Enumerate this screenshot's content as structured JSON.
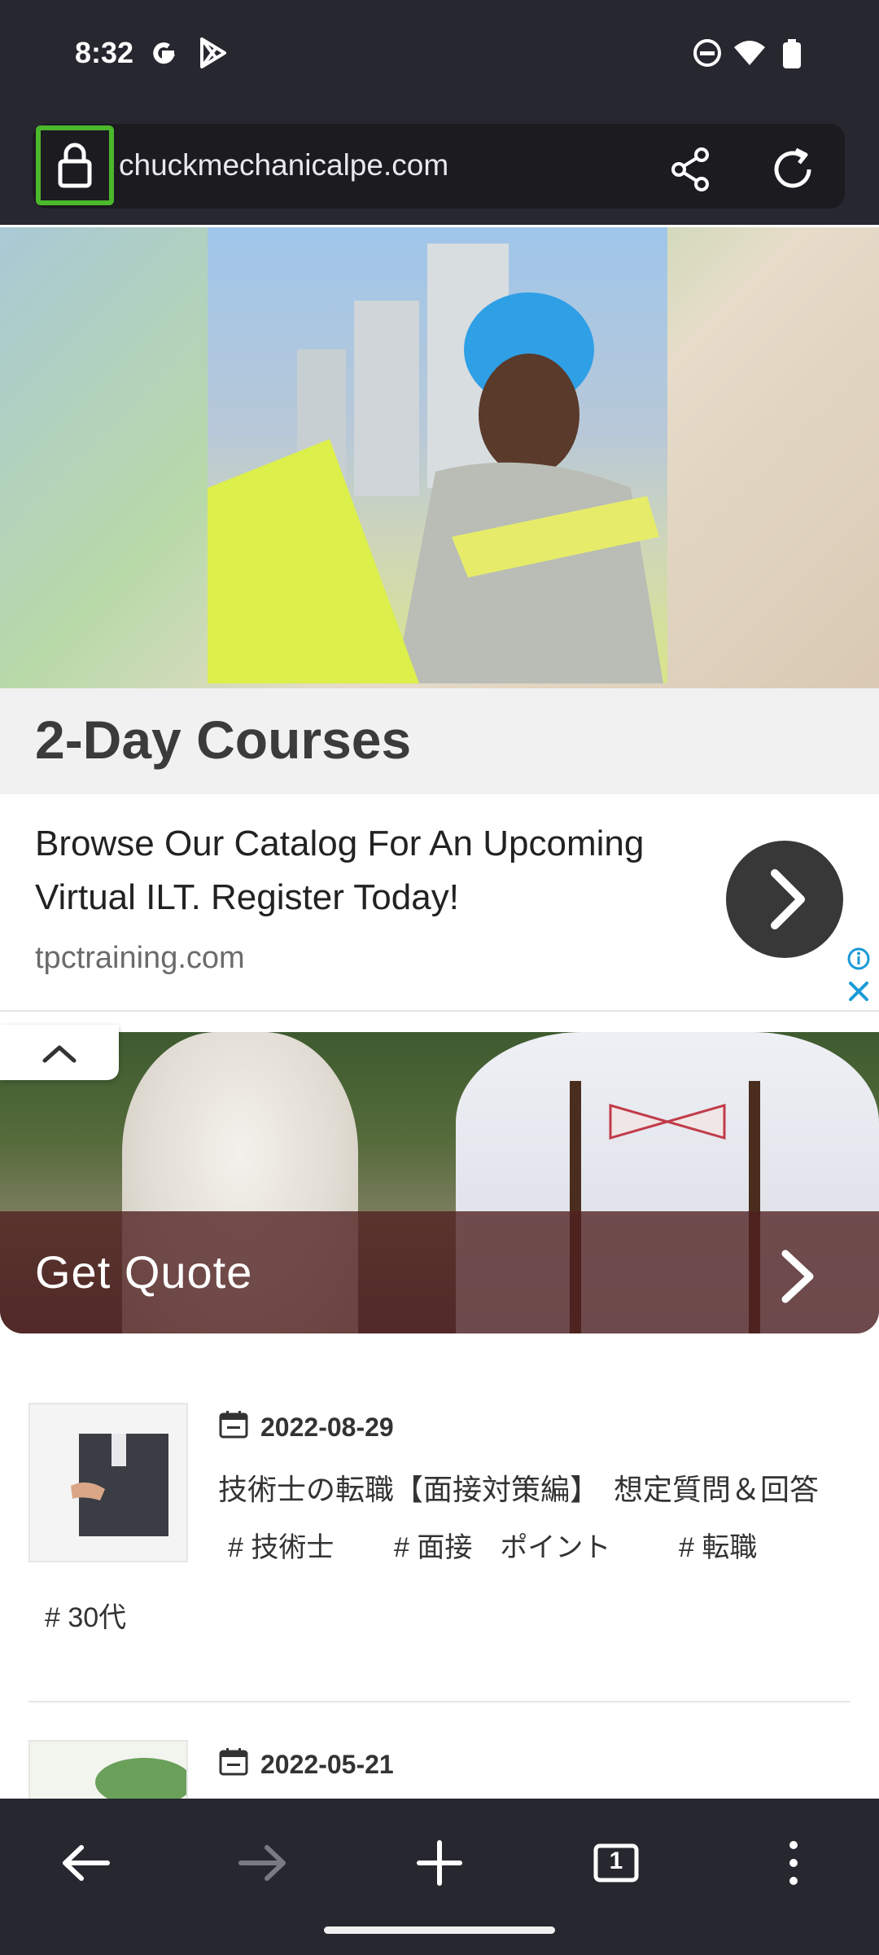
{
  "status_bar": {
    "time": "8:32",
    "left_icons": [
      "google-icon",
      "play-store-icon"
    ],
    "right_icons": [
      "do-not-disturb-icon",
      "wifi-icon",
      "battery-icon"
    ]
  },
  "browser": {
    "url": "chuckmechanicalpe.com",
    "share_label": "share",
    "reload_label": "reload",
    "tab_count": "1"
  },
  "ad": {
    "title": "2-Day Courses",
    "description": "Browse Our Catalog For An Upcoming Virtual ILT. Register Today!",
    "domain": "tpctraining.com"
  },
  "banner": {
    "cta": "Get Quote"
  },
  "articles": [
    {
      "date": "2022-08-29",
      "title": "技術士の転職【面接対策編】　想定質問＆回答",
      "tags": [
        "# 技術士",
        "# 面接　ポイント",
        "# 転職",
        "# 30代"
      ]
    },
    {
      "date": "2022-05-21"
    }
  ],
  "colors": {
    "chrome_bg": "#272730",
    "url_bar_bg": "#1b1b20",
    "focus_outline": "#4cb82c",
    "ad_cta_bg": "#383838",
    "quote_band": "#502020"
  }
}
